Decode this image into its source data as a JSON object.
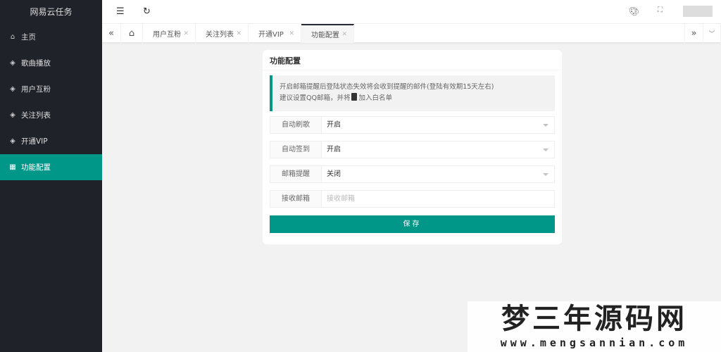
{
  "app_title": "网易云任务",
  "sidebar": {
    "items": [
      {
        "label": "主页",
        "icon": "home-icon"
      },
      {
        "label": "歌曲播放",
        "icon": "diamond-icon"
      },
      {
        "label": "用户互粉",
        "icon": "diamond-icon"
      },
      {
        "label": "关注列表",
        "icon": "diamond-icon"
      },
      {
        "label": "开通VIP",
        "icon": "diamond-icon"
      },
      {
        "label": "功能配置",
        "icon": "apps-icon",
        "active": true
      }
    ]
  },
  "tabs": [
    {
      "label": "用户互粉"
    },
    {
      "label": "关注列表"
    },
    {
      "label": "开通VIP"
    },
    {
      "label": "功能配置",
      "active": true
    }
  ],
  "card": {
    "title": "功能配置",
    "note_line1": "开启邮箱提醒后登陆状态失效将会收到提醒的邮件(登陆有效期15天左右)",
    "note_line2a": "建议设置QQ邮箱，并将",
    "note_line2b": "加入白名单",
    "fields": [
      {
        "label": "自动刷歌",
        "value": "开启"
      },
      {
        "label": "自动签到",
        "value": "开启"
      },
      {
        "label": "邮箱提醒",
        "value": "关闭"
      },
      {
        "label": "接收邮箱",
        "placeholder": "接收邮箱"
      }
    ],
    "save_label": "保存"
  },
  "watermark": {
    "line1": "梦三年源码网",
    "line2": "www.mengsannian.com"
  },
  "colors": {
    "accent": "#009688",
    "sidebar": "#20222a"
  }
}
